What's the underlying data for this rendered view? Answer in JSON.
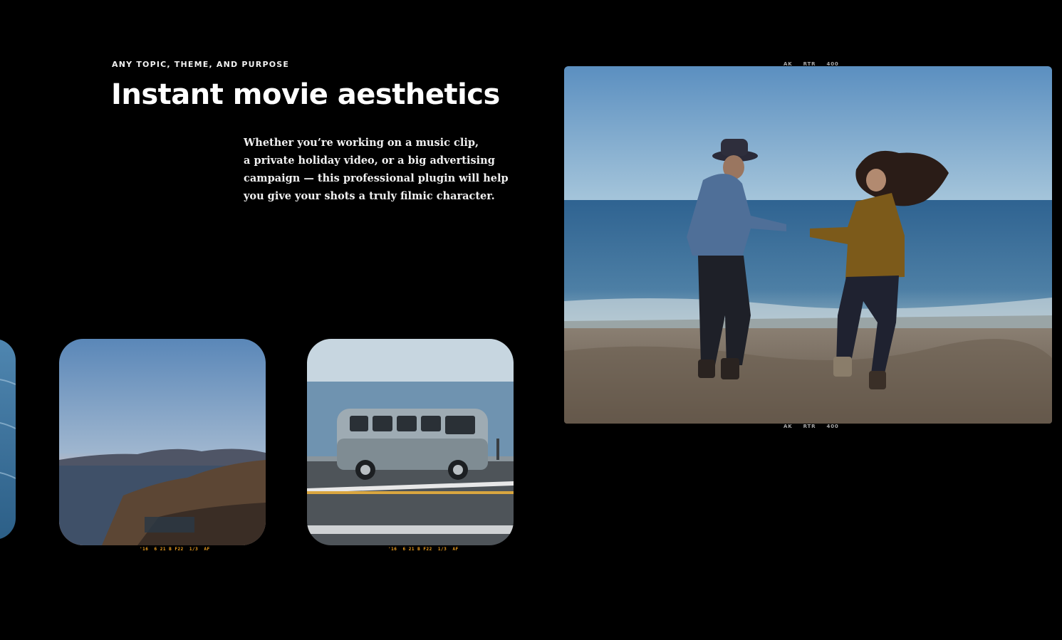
{
  "section": {
    "eyebrow": "ANY TOPIC, THEME, AND PURPOSE",
    "headline": "Instant movie aesthetics",
    "body_lines": [
      "Whether you’re working on a music clip,",
      "a private holiday video, or a big advertising",
      "campaign — this professional plugin will help",
      "you give your shots a truly filmic character."
    ]
  },
  "hero_image": {
    "film_code_top": "AK RTR 400",
    "film_code_bottom": "AK RTR 400"
  },
  "thumbnails": [
    {
      "name": "cliffs-sunset",
      "stamp": "'16  6 21 B F22  1/3  AF"
    },
    {
      "name": "van-road",
      "stamp": "'16  6 21 B F22  1/3  AF"
    }
  ],
  "colors": {
    "background": "#000000",
    "text": "#ffffff",
    "stamp": "#f0a020"
  }
}
